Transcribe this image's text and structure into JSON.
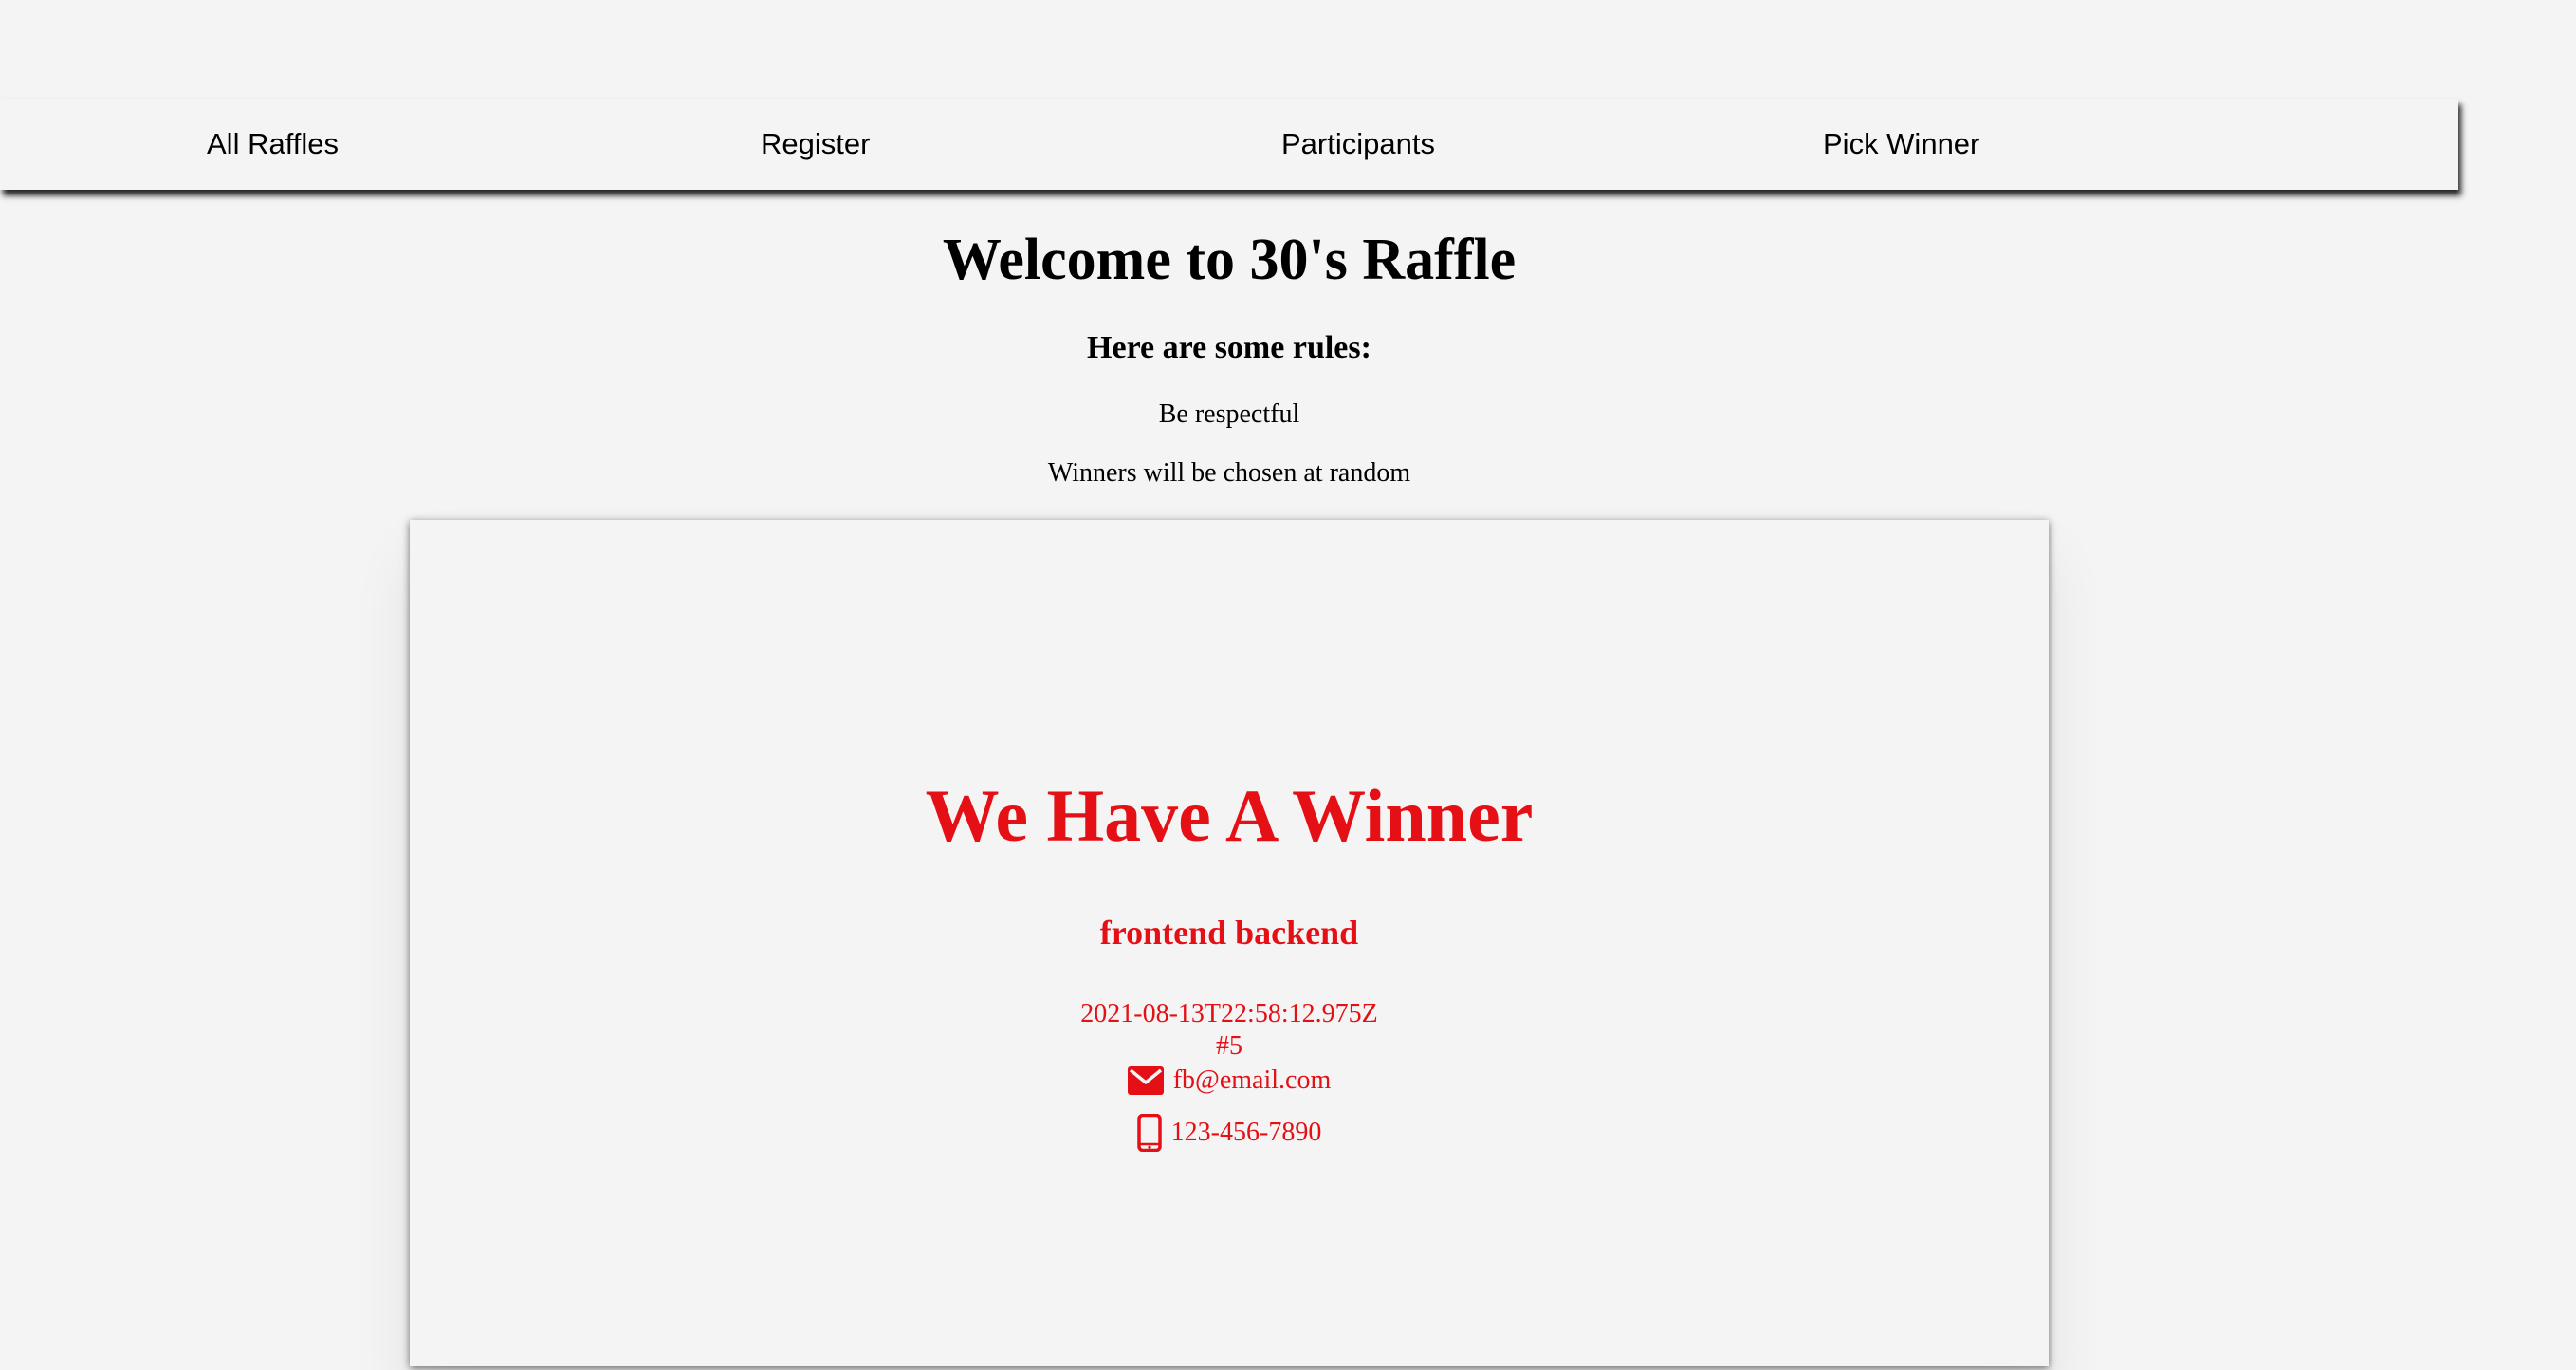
{
  "nav": {
    "items": [
      {
        "label": "All Raffles"
      },
      {
        "label": "Register"
      },
      {
        "label": "Participants"
      },
      {
        "label": "Pick Winner"
      }
    ]
  },
  "page": {
    "title": "Welcome to 30's Raffle",
    "rules_heading": "Here are some rules:",
    "rules": [
      "Be respectful",
      "Winners will be chosen at random"
    ]
  },
  "winner": {
    "heading": "We Have A Winner",
    "name": "frontend backend",
    "date": "2021-08-13T22:58:12.975Z",
    "number": "#5",
    "email": "fb@email.com",
    "phone": "123-456-7890",
    "email_icon": "envelope-icon",
    "phone_icon": "mobile-phone-icon",
    "color": "#e51016"
  }
}
